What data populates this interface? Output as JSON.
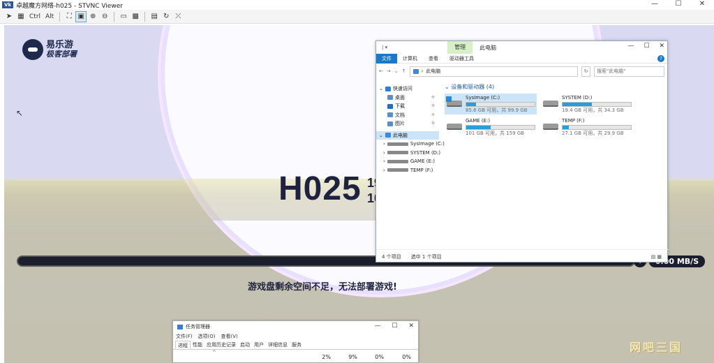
{
  "window": {
    "title": "卓越魔方网络-h025 - STVNC Viewer",
    "app_icon": "Vk",
    "controls": [
      "—",
      "☐",
      "✕"
    ]
  },
  "toolbar": {
    "ctrl_label": "Ctrl",
    "alt_label": "Alt"
  },
  "desktop": {
    "logo_name": "易乐游",
    "logo_sub": "极客部署",
    "hostname": "H025",
    "hostname_side": [
      "19",
      "10"
    ],
    "progress_fraction": 0.0,
    "speed": "0.00 MB/S",
    "message": "游戏盘剩余空间不足，无法部署游戏!",
    "watermark": "网吧三国"
  },
  "explorer": {
    "quick_access": "| ▾",
    "manage_tab": "管理",
    "title": "此电脑",
    "controls": [
      "—",
      "☐",
      "✕"
    ],
    "ribbon": {
      "file": "文件",
      "computer": "计算机",
      "view": "查看",
      "drive_tools": "驱动器工具",
      "help": "?"
    },
    "address": {
      "path": "此电脑",
      "search_placeholder": "搜索\"此电脑\""
    },
    "nav": {
      "quick_access": "快速访问",
      "desktop": "桌面",
      "downloads": "下载",
      "documents": "文档",
      "pictures": "图片",
      "this_pc": "此电脑",
      "drives": [
        "SysImage (C:)",
        "SYSTEM (D:)",
        "GAME (E:)",
        "TEMP (F:)"
      ]
    },
    "group_title": "设备和驱动器 (4)",
    "drives": [
      {
        "name": "SysImage (C:)",
        "info": "85.6 GB 可用，共 99.9 GB",
        "used_fraction": 0.14,
        "system": true
      },
      {
        "name": "SYSTEM (D:)",
        "info": "19.4 GB 可用，共 34.3 GB",
        "used_fraction": 0.43,
        "system": false
      },
      {
        "name": "GAME (E:)",
        "info": "101 GB 可用，共 159 GB",
        "used_fraction": 0.36,
        "system": false
      },
      {
        "name": "TEMP (F:)",
        "info": "27.1 GB 可用，共 29.9 GB",
        "used_fraction": 0.09,
        "system": false
      }
    ],
    "status": {
      "items": "4 个项目",
      "selected": "选中 1 个项目"
    }
  },
  "taskmgr": {
    "title": "任务管理器",
    "menu": [
      "文件(F)",
      "选项(O)",
      "查看(V)"
    ],
    "tabs": [
      "进程",
      "性能",
      "应用历史记录",
      "启动",
      "用户",
      "详细信息",
      "服务"
    ],
    "columns": [
      "2%",
      "9%",
      "0%",
      "0%"
    ]
  },
  "colors": {
    "accent": "#1979ca",
    "drive_bar": "#26a0da",
    "manage_tab": "#d8f0c8",
    "dark_panel": "#1b1e2c"
  }
}
